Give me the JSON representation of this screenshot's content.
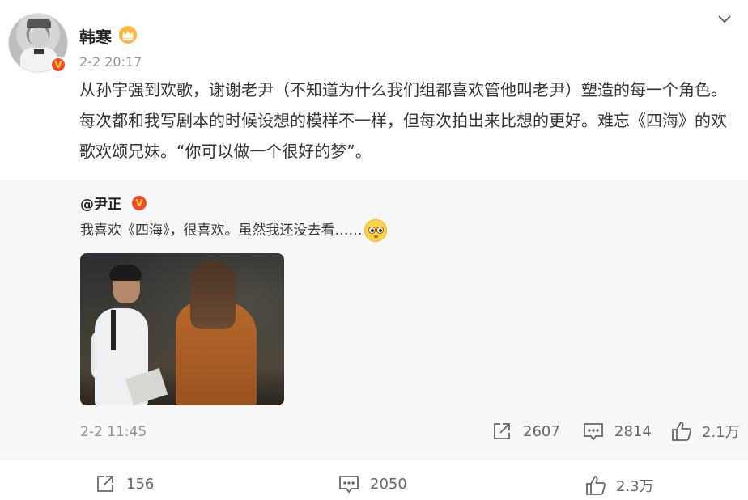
{
  "author": {
    "name": "韩寒",
    "time": "2-2 20:17",
    "badges": [
      "vip-crown-icon",
      "verified-v-icon"
    ]
  },
  "post": {
    "text": "从孙宇强到欢歌，谢谢老尹（不知道为什么我们组都喜欢管他叫老尹）塑造的每一个角色。每次都和我写剧本的时候设想的模样不一样，但每次拍出来比想的更好。难忘《四海》的欢歌欢颂兄妹。“你可以做一个很好的梦”。"
  },
  "repost": {
    "author": "@尹正",
    "text": "我喜欢《四海》，很喜欢。虽然我还没去看……",
    "emoji": "face-without-mouth-eyes-icon",
    "time": "2-2 11:45",
    "actions": {
      "share": "2607",
      "comment": "2814",
      "like": "2.1万"
    }
  },
  "actions": {
    "share": "156",
    "comment": "2050",
    "like": "2.3万"
  },
  "colors": {
    "verified": "#f74a2a",
    "crown": "#ffb43b",
    "repost_bg": "#f7f7f7",
    "muted_text": "#939393"
  }
}
